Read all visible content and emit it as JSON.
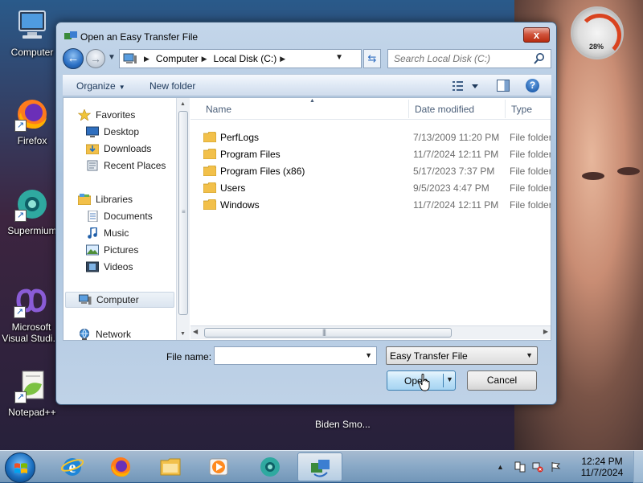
{
  "desktop": {
    "icons": [
      {
        "label": "Computer"
      },
      {
        "label": "Firefox"
      },
      {
        "label": "Supermium"
      },
      {
        "label": "Microsoft Visual Studi..."
      },
      {
        "label": "Notepad++"
      }
    ],
    "window_caption": "Biden Smo...",
    "gadget_value": "28%"
  },
  "dialog": {
    "title": "Open an Easy Transfer File",
    "close_label": "x",
    "address": {
      "crumbs": [
        "Computer",
        "Local Disk (C:)"
      ]
    },
    "search": {
      "placeholder": "Search Local Disk (C:)"
    },
    "toolbar": {
      "organize_label": "Organize",
      "new_folder_label": "New folder"
    },
    "nav": {
      "favorites_header": "Favorites",
      "favorites": [
        "Desktop",
        "Downloads",
        "Recent Places"
      ],
      "libraries_header": "Libraries",
      "libraries": [
        "Documents",
        "Music",
        "Pictures",
        "Videos"
      ],
      "computer": "Computer",
      "network": "Network"
    },
    "columns": {
      "name": "Name",
      "date": "Date modified",
      "type": "Type"
    },
    "files": [
      {
        "name": "PerfLogs",
        "date": "7/13/2009 11:20 PM",
        "type": "File folder"
      },
      {
        "name": "Program Files",
        "date": "11/7/2024 12:11 PM",
        "type": "File folder"
      },
      {
        "name": "Program Files (x86)",
        "date": "5/17/2023 7:37 PM",
        "type": "File folder"
      },
      {
        "name": "Users",
        "date": "9/5/2023 4:47 PM",
        "type": "File folder"
      },
      {
        "name": "Windows",
        "date": "11/7/2024 12:11 PM",
        "type": "File folder"
      }
    ],
    "file_name_label": "File name:",
    "file_name_value": "",
    "filter": "Easy Transfer File",
    "open_label": "Open",
    "cancel_label": "Cancel"
  },
  "taskbar": {
    "clock_time": "12:24 PM",
    "clock_date": "11/7/2024"
  },
  "colors": {
    "accent": "#2a6fc4",
    "close": "#c8432a",
    "folder": "#f2c04a"
  }
}
